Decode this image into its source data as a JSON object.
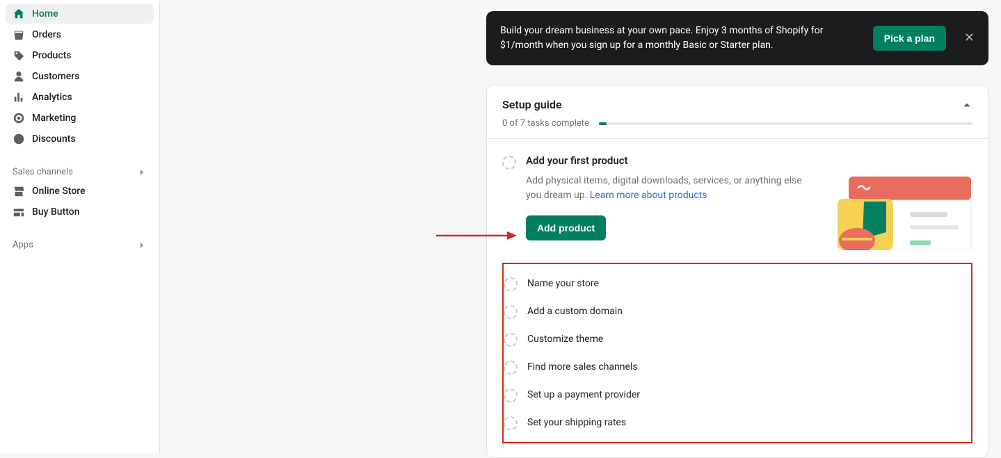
{
  "sidebar": {
    "nav": [
      {
        "label": "Home"
      },
      {
        "label": "Orders"
      },
      {
        "label": "Products"
      },
      {
        "label": "Customers"
      },
      {
        "label": "Analytics"
      },
      {
        "label": "Marketing"
      },
      {
        "label": "Discounts"
      }
    ],
    "sales_channels_label": "Sales channels",
    "channels": [
      {
        "label": "Online Store"
      },
      {
        "label": "Buy Button"
      }
    ],
    "apps_label": "Apps"
  },
  "banner": {
    "text": "Build your dream business at your own pace. Enjoy 3 months of Shopify for $1/month when you sign up for a monthly Basic or Starter plan.",
    "cta": "Pick a plan"
  },
  "setup": {
    "title": "Setup guide",
    "progress_text": "0 of 7 tasks complete",
    "featured": {
      "title": "Add your first product",
      "desc": "Add physical items, digital downloads, services, or anything else you dream up. ",
      "link_text": "Learn more about products",
      "cta": "Add product"
    },
    "tasks": [
      {
        "label": "Name your store"
      },
      {
        "label": "Add a custom domain"
      },
      {
        "label": "Customize theme"
      },
      {
        "label": "Find more sales channels"
      },
      {
        "label": "Set up a payment provider"
      },
      {
        "label": "Set your shipping rates"
      }
    ]
  }
}
